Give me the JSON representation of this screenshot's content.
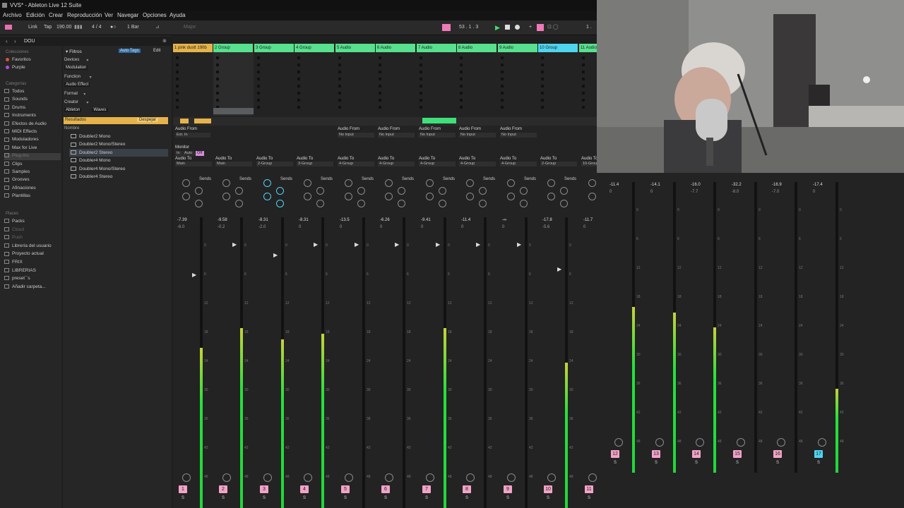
{
  "window": {
    "title": "VVS* - Ableton Live 12 Suite"
  },
  "menu": [
    "Archivo",
    "Edición",
    "Crear",
    "Reproducción",
    "Ver",
    "Navegar",
    "Opciones",
    "Ayuda"
  ],
  "transport": {
    "link": "Link",
    "tap": "Tap",
    "bpm": "190.00",
    "signature": "4 / 4",
    "quant": "1 Bar",
    "key": "Major",
    "position": "53 .  1 .  3",
    "loop": "1 ."
  },
  "browser": {
    "search_text": "DOU",
    "filters_label": "Filtros",
    "auto_tags_label": "Auto Tags",
    "edit_label": "Edit",
    "colecciones_head": "Colecciones",
    "colecciones": [
      {
        "label": "Favoritos",
        "color": "#e0503a"
      },
      {
        "label": "Purple",
        "color": "#b04ce0"
      }
    ],
    "categorias_head": "Categorías",
    "categorias": [
      "Todos",
      "Sounds",
      "Drums",
      "Instruments",
      "Efectos de Audio",
      "MIDI Effects",
      "Moduladores",
      "Max for Live",
      "Plug-Ins",
      "Clips",
      "Samples",
      "Grooves",
      "Afinaciones",
      "Plantillas"
    ],
    "places_head": "Places",
    "places": [
      "Packs",
      "Cloud",
      "Push",
      "Librería del usuario",
      "Proyecto actual",
      "FRIX",
      "LIBRERIAS",
      "preset``s",
      "Añadir carpeta..."
    ],
    "filter_groups": [
      {
        "label": "Devices",
        "chips": [
          "Modulation"
        ]
      },
      {
        "label": "Function",
        "chips": [
          "Audio Effect"
        ]
      },
      {
        "label": "Format",
        "chips": []
      },
      {
        "label": "Creator",
        "chips": [
          "Ableton",
          "Waves"
        ]
      }
    ],
    "results_label": "Resultados",
    "clear_label": "Despejar",
    "name_col": "Nombre",
    "results": [
      "Doubler2 Mono",
      "Doubler2 Mono/Stereo",
      "Doubler2 Stereo",
      "Doubler4 Mono",
      "Doubler4 Mono/Stereo",
      "Doubler4 Stereo"
    ]
  },
  "session": {
    "tracks": [
      {
        "name": "1 pink dustt 190b",
        "color": "#e6b34a"
      },
      {
        "name": "2 Group",
        "color": "#57e08d"
      },
      {
        "name": "3 Group",
        "color": "#57e08d"
      },
      {
        "name": "4 Group",
        "color": "#57e08d"
      },
      {
        "name": "5 Audio",
        "color": "#57e08d"
      },
      {
        "name": "6 Audio",
        "color": "#57e08d"
      },
      {
        "name": "7 Audio",
        "color": "#57e08d"
      },
      {
        "name": "8 Audio",
        "color": "#57e08d"
      },
      {
        "name": "9 Audio",
        "color": "#57e08d"
      },
      {
        "name": "10 Group",
        "color": "#4fd4f0"
      },
      {
        "name": "11 Audio",
        "color": "#57e08d"
      }
    ],
    "io": {
      "audio_from": "Audio From",
      "ext_in": "Ext. In",
      "no_input": "No Input",
      "monitor": "Monitor",
      "in": "In",
      "auto": "Auto",
      "off": "Off",
      "audio_to": "Audio To",
      "sends": "Sends"
    },
    "routes": [
      "Main",
      "Main",
      "2-Group",
      "3-Group",
      "4-Group",
      "4-Group",
      "4-Group",
      "4-Group",
      "4-Group",
      "2-Group",
      "10-Grou"
    ]
  },
  "mixer": {
    "strips": [
      {
        "num": "1",
        "vol": "-7.39",
        "peak": "-6.0",
        "level": 0.55
      },
      {
        "num": "2",
        "vol": "-9.58",
        "peak": "-0.2",
        "level": 0.62
      },
      {
        "num": "3",
        "vol": "-8.31",
        "peak": "-2.0",
        "level": 0.58
      },
      {
        "num": "4",
        "vol": "-8.31",
        "peak": "0",
        "level": 0.6
      },
      {
        "num": "5",
        "vol": "-13.5",
        "peak": "0",
        "level": 0
      },
      {
        "num": "6",
        "vol": "-6.26",
        "peak": "0",
        "level": 0
      },
      {
        "num": "7",
        "vol": "-9.41",
        "peak": "0",
        "level": 0.62
      },
      {
        "num": "8",
        "vol": "-11.4",
        "peak": "0",
        "level": 0
      },
      {
        "num": "9",
        "vol": "-∞",
        "peak": "0",
        "level": 0
      },
      {
        "num": "10",
        "vol": "-17.8",
        "peak": "-5.6",
        "level": 0.5
      },
      {
        "num": "11",
        "vol": "-11.7",
        "peak": "0",
        "level": 0.55
      },
      {
        "num": "12",
        "vol": "-11.4",
        "peak": "0",
        "level": 0.57
      },
      {
        "num": "13",
        "vol": "-14.1",
        "peak": "0",
        "level": 0.55
      },
      {
        "num": "14",
        "vol": "-16.0",
        "peak": "-7.7",
        "level": 0.5
      },
      {
        "num": "15",
        "vol": "-32.2",
        "peak": "-8.0",
        "level": 0
      },
      {
        "num": "16",
        "vol": "-16.9",
        "peak": "-7.0",
        "level": 0
      },
      {
        "num": "17",
        "vol": "-17.4",
        "peak": "0",
        "level": 0.29
      }
    ],
    "scale": [
      "0",
      "6",
      "12",
      "18",
      "24",
      "30",
      "36",
      "42",
      "48",
      "54",
      "60"
    ]
  }
}
